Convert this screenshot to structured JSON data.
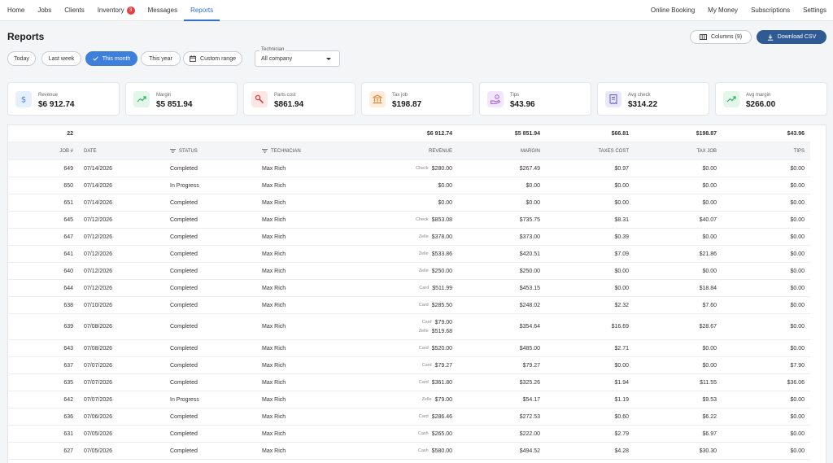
{
  "nav": {
    "left": [
      {
        "label": "Home"
      },
      {
        "label": "Jobs"
      },
      {
        "label": "Clients"
      },
      {
        "label": "Inventory",
        "badge": "3"
      },
      {
        "label": "Messages"
      },
      {
        "label": "Reports",
        "active": true
      }
    ],
    "right": [
      {
        "label": "Online Booking"
      },
      {
        "label": "My Money"
      },
      {
        "label": "Subscriptions"
      },
      {
        "label": "Settings"
      }
    ]
  },
  "page": {
    "title": "Reports",
    "columns_label": "Columns (9)",
    "csv_label": "Download CSV"
  },
  "filters": {
    "chips": [
      {
        "label": "Today"
      },
      {
        "label": "Last week"
      },
      {
        "label": "This month",
        "active": true
      },
      {
        "label": "This year"
      },
      {
        "label": "Custom range"
      }
    ],
    "technician": {
      "label": "Technician",
      "value": "All company"
    }
  },
  "cards": [
    {
      "label": "Revenue",
      "value": "$6 912.74",
      "icon": "dollar-icon",
      "bg": "#e6effc",
      "fg": "#3f7fdc"
    },
    {
      "label": "Margin",
      "value": "$5 851.94",
      "icon": "trend-up-icon",
      "bg": "#e3f6ea",
      "fg": "#2fae62"
    },
    {
      "label": "Parts cost",
      "value": "$861.94",
      "icon": "wrench-icon",
      "bg": "#fde6e6",
      "fg": "#d9413f"
    },
    {
      "label": "Tax job",
      "value": "$198.87",
      "icon": "bank-icon",
      "bg": "#fdeede",
      "fg": "#e8822b"
    },
    {
      "label": "Tips",
      "value": "$43.96",
      "icon": "hand-coin-icon",
      "bg": "#f1e6fb",
      "fg": "#9b57d6"
    },
    {
      "label": "Avg check",
      "value": "$314.22",
      "icon": "receipt-icon",
      "bg": "#e9e8fb",
      "fg": "#5b56c9"
    },
    {
      "label": "Avg margin",
      "value": "$266.00",
      "icon": "trend-up-icon",
      "bg": "#e3f6ea",
      "fg": "#2fae62"
    }
  ],
  "table": {
    "totals": {
      "count": "22",
      "revenue": "$6 912.74",
      "margin": "$5 851.94",
      "taxes_cost": "$66.81",
      "tax_job": "$198.87",
      "tips": "$43.96"
    },
    "headers": {
      "job": "Job #",
      "date": "Date",
      "status": "Status",
      "technician": "Technician",
      "revenue": "Revenue",
      "margin": "Margin",
      "taxes_cost": "Taxes cost",
      "tax_job": "Tax job",
      "tips": "Tips"
    },
    "rows": [
      {
        "job": "649",
        "date": "07/14/2026",
        "status": "Completed",
        "tech": "Max Rich",
        "revenue": [
          {
            "method": "Check",
            "amount": "$280.00"
          }
        ],
        "margin": "$267.49",
        "taxes_cost": "$0.97",
        "tax_job": "$0.00",
        "tips": "$0.00"
      },
      {
        "job": "650",
        "date": "07/14/2026",
        "status": "In Progress",
        "tech": "Max Rich",
        "revenue": [
          {
            "method": "",
            "amount": "$0.00"
          }
        ],
        "margin": "$0.00",
        "taxes_cost": "$0.00",
        "tax_job": "$0.00",
        "tips": "$0.00"
      },
      {
        "job": "651",
        "date": "07/14/2026",
        "status": "Completed",
        "tech": "Max Rich",
        "revenue": [
          {
            "method": "",
            "amount": "$0.00"
          }
        ],
        "margin": "$0.00",
        "taxes_cost": "$0.00",
        "tax_job": "$0.00",
        "tips": "$0.00"
      },
      {
        "job": "645",
        "date": "07/12/2026",
        "status": "Completed",
        "tech": "Max Rich",
        "revenue": [
          {
            "method": "Check",
            "amount": "$853.08"
          }
        ],
        "margin": "$735.75",
        "taxes_cost": "$8.31",
        "tax_job": "$40.07",
        "tips": "$0.00"
      },
      {
        "job": "647",
        "date": "07/12/2026",
        "status": "Completed",
        "tech": "Max Rich",
        "revenue": [
          {
            "method": "Zelle",
            "amount": "$378.00"
          }
        ],
        "margin": "$373.00",
        "taxes_cost": "$0.39",
        "tax_job": "$0.00",
        "tips": "$0.00"
      },
      {
        "job": "641",
        "date": "07/12/2026",
        "status": "Completed",
        "tech": "Max Rich",
        "revenue": [
          {
            "method": "Zelle",
            "amount": "$533.86"
          }
        ],
        "margin": "$420.51",
        "taxes_cost": "$7.09",
        "tax_job": "$21.86",
        "tips": "$0.00"
      },
      {
        "job": "640",
        "date": "07/12/2026",
        "status": "Completed",
        "tech": "Max Rich",
        "revenue": [
          {
            "method": "Zelle",
            "amount": "$250.00"
          }
        ],
        "margin": "$250.00",
        "taxes_cost": "$0.00",
        "tax_job": "$0.00",
        "tips": "$0.00"
      },
      {
        "job": "644",
        "date": "07/12/2026",
        "status": "Completed",
        "tech": "Max Rich",
        "revenue": [
          {
            "method": "Card",
            "amount": "$511.99"
          }
        ],
        "margin": "$453.15",
        "taxes_cost": "$0.00",
        "tax_job": "$18.84",
        "tips": "$0.00"
      },
      {
        "job": "638",
        "date": "07/10/2026",
        "status": "Completed",
        "tech": "Max Rich",
        "revenue": [
          {
            "method": "Card",
            "amount": "$285.50"
          }
        ],
        "margin": "$248.02",
        "taxes_cost": "$2.32",
        "tax_job": "$7.60",
        "tips": "$0.00"
      },
      {
        "job": "639",
        "date": "07/08/2026",
        "status": "Completed",
        "tech": "Max Rich",
        "revenue": [
          {
            "method": "Card",
            "amount": "$79.00"
          },
          {
            "method": "Zelle",
            "amount": "$519.68"
          }
        ],
        "margin": "$354.64",
        "taxes_cost": "$16.69",
        "tax_job": "$28.67",
        "tips": "$0.00"
      },
      {
        "job": "643",
        "date": "07/08/2026",
        "status": "Completed",
        "tech": "Max Rich",
        "revenue": [
          {
            "method": "Card",
            "amount": "$520.00"
          }
        ],
        "margin": "$485.00",
        "taxes_cost": "$2.71",
        "tax_job": "$0.00",
        "tips": "$0.00"
      },
      {
        "job": "637",
        "date": "07/07/2026",
        "status": "Completed",
        "tech": "Max Rich",
        "revenue": [
          {
            "method": "Card",
            "amount": "$79.27"
          }
        ],
        "margin": "$79.27",
        "taxes_cost": "$0.00",
        "tax_job": "$0.00",
        "tips": "$7.90"
      },
      {
        "job": "635",
        "date": "07/07/2026",
        "status": "Completed",
        "tech": "Max Rich",
        "revenue": [
          {
            "method": "Card",
            "amount": "$361.80"
          }
        ],
        "margin": "$325.26",
        "taxes_cost": "$1.94",
        "tax_job": "$11.55",
        "tips": "$36.06"
      },
      {
        "job": "642",
        "date": "07/07/2026",
        "status": "In Progress",
        "tech": "Max Rich",
        "revenue": [
          {
            "method": "Zelle",
            "amount": "$79.00"
          }
        ],
        "margin": "$54.17",
        "taxes_cost": "$1.19",
        "tax_job": "$9.53",
        "tips": "$0.00"
      },
      {
        "job": "636",
        "date": "07/06/2026",
        "status": "Completed",
        "tech": "Max Rich",
        "revenue": [
          {
            "method": "Card",
            "amount": "$286.46"
          }
        ],
        "margin": "$272.53",
        "taxes_cost": "$0.60",
        "tax_job": "$6.22",
        "tips": "$0.00"
      },
      {
        "job": "631",
        "date": "07/05/2026",
        "status": "Completed",
        "tech": "Max Rich",
        "revenue": [
          {
            "method": "Cash",
            "amount": "$265.00"
          }
        ],
        "margin": "$222.00",
        "taxes_cost": "$2.79",
        "tax_job": "$6.97",
        "tips": "$0.00"
      },
      {
        "job": "627",
        "date": "07/05/2026",
        "status": "Completed",
        "tech": "Max Rich",
        "revenue": [
          {
            "method": "Cash",
            "amount": "$580.00"
          }
        ],
        "margin": "$494.52",
        "taxes_cost": "$4.28",
        "tax_job": "$30.30",
        "tips": "$0.00"
      }
    ]
  }
}
